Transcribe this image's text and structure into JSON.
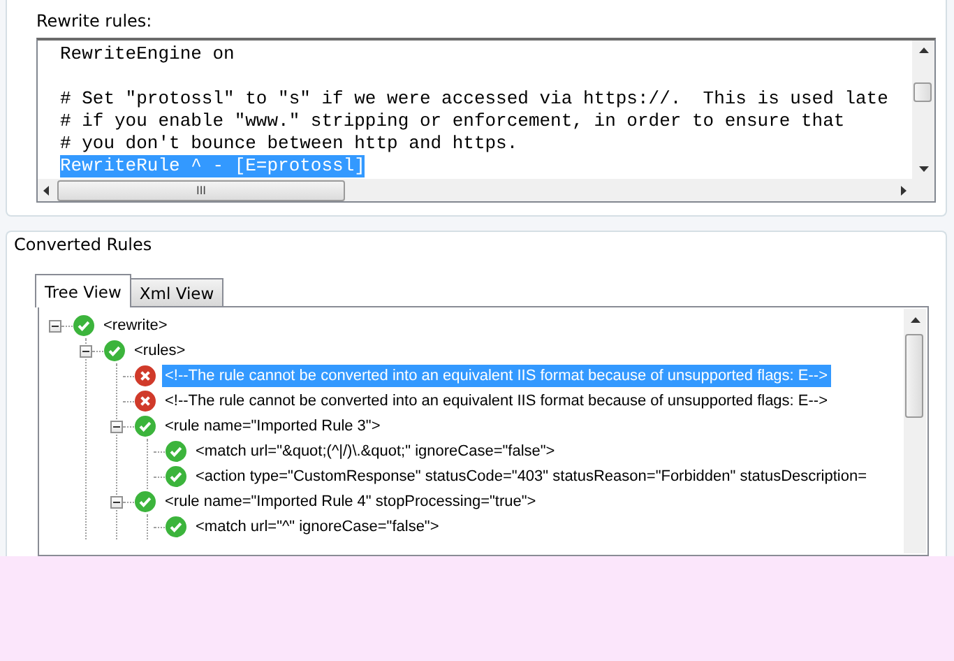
{
  "rewrite_rules": {
    "label": "Rewrite rules:",
    "paragraphs": [
      {
        "lines": [
          {
            "text": "RewriteEngine on",
            "selected": false
          }
        ]
      },
      {
        "lines": [
          {
            "text": "# Set \"protossl\" to \"s\" if we were accessed via https://.  This is used late",
            "selected": false
          },
          {
            "text": "# if you enable \"www.\" stripping or enforcement, in order to ensure that",
            "selected": false
          },
          {
            "text": "# you don't bounce between http and https.",
            "selected": false
          },
          {
            "text": "RewriteRule ^ - [E=protossl]",
            "selected": true
          }
        ]
      }
    ],
    "scroll_marker": "III"
  },
  "converted_rules": {
    "label": "Converted Rules",
    "tabs": [
      {
        "label": "Tree View",
        "selected": true
      },
      {
        "label": "Xml View",
        "selected": false
      }
    ],
    "tree": [
      {
        "text": "<rewrite>",
        "kind": "ok",
        "expanded": true,
        "selected": false,
        "children": [
          {
            "text": "<rules>",
            "kind": "ok",
            "expanded": true,
            "selected": false,
            "children": [
              {
                "text": "<!--The rule cannot be converted into an equivalent IIS format because of unsupported flags: E-->",
                "kind": "error",
                "selected": true
              },
              {
                "text": "<!--The rule cannot be converted into an equivalent IIS format because of unsupported flags: E-->",
                "kind": "error",
                "selected": false
              },
              {
                "text": "<rule name=\"Imported Rule 3\">",
                "kind": "ok",
                "expanded": true,
                "selected": false,
                "children": [
                  {
                    "text": "<match url=\"&quot;(^|/)\\.&quot;\" ignoreCase=\"false\">",
                    "kind": "ok",
                    "selected": false
                  },
                  {
                    "text": "<action type=\"CustomResponse\" statusCode=\"403\" statusReason=\"Forbidden\" statusDescription=",
                    "kind": "ok",
                    "selected": false
                  }
                ]
              },
              {
                "text": "<rule name=\"Imported Rule 4\" stopProcessing=\"true\">",
                "kind": "ok",
                "expanded": true,
                "selected": false,
                "children": [
                  {
                    "text": "<match url=\"^\" ignoreCase=\"false\">",
                    "kind": "ok",
                    "selected": false
                  }
                ]
              }
            ]
          }
        ]
      }
    ]
  }
}
